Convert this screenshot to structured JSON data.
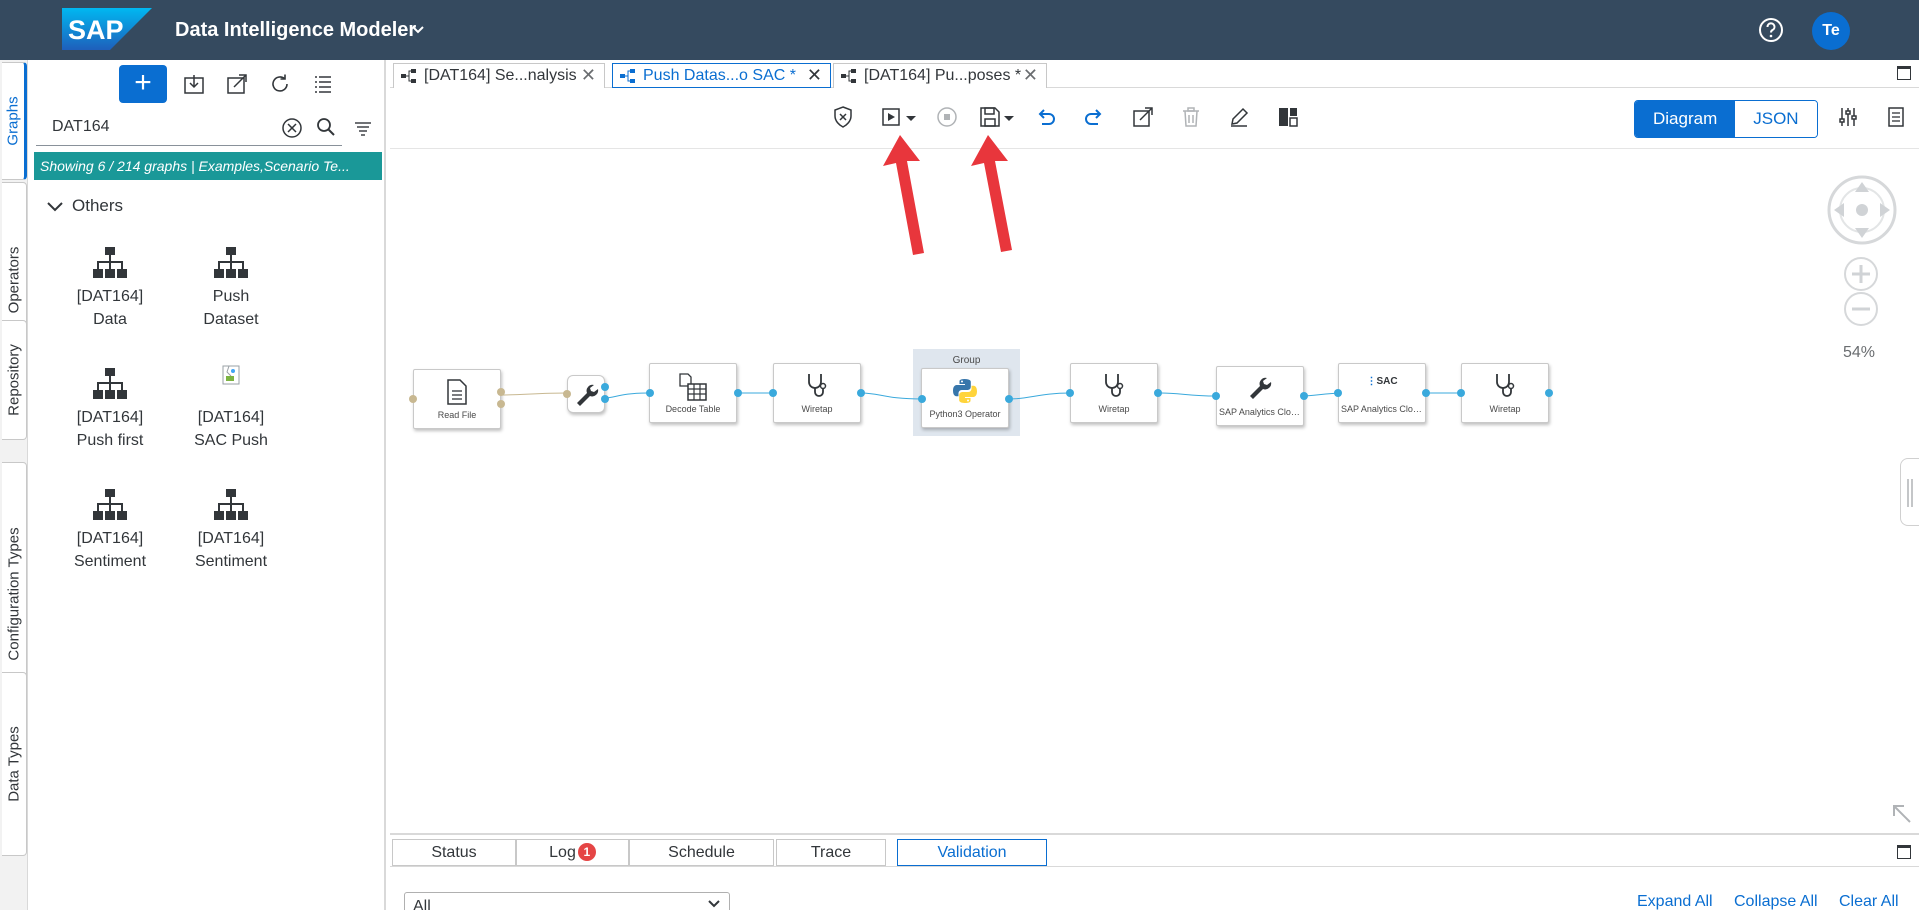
{
  "shell": {
    "logo_text": "SAP",
    "app_title": "Data Intelligence Modeler",
    "user_initials": "Te"
  },
  "vertical_tabs": [
    {
      "label": "Graphs",
      "active": true
    },
    {
      "label": "Operators"
    },
    {
      "label": "Repository"
    },
    {
      "label": "Configuration Types"
    },
    {
      "label": "Data Types"
    }
  ],
  "left_panel": {
    "search_value": "DAT164",
    "info_text": "Showing 6 / 214 graphs | Examples,Scenario Te...",
    "group_name": "Others",
    "graphs": [
      {
        "line1": "[DAT164]",
        "line2": "Data"
      },
      {
        "line1": "Push",
        "line2": "Dataset"
      },
      {
        "line1": "[DAT164]",
        "line2": "Push first"
      },
      {
        "line1": "[DAT164]",
        "line2": "SAC Push"
      },
      {
        "line1": "[DAT164]",
        "line2": "Sentiment"
      },
      {
        "line1": "[DAT164]",
        "line2": "Sentiment"
      }
    ]
  },
  "doc_tabs": [
    {
      "label": "[DAT164] Se...nalysis"
    },
    {
      "label": "Push Datas...o SAC *",
      "active": true
    },
    {
      "label": "[DAT164] Pu...poses *"
    }
  ],
  "view_toggle": {
    "diagram": "Diagram",
    "json": "JSON"
  },
  "canvas": {
    "group_label": "Group",
    "zoom_level": "54%",
    "nodes": [
      {
        "label": "Read File"
      },
      {
        "label": "Decode Table"
      },
      {
        "label": "Wiretap"
      },
      {
        "label": "Python3 Operator"
      },
      {
        "label": "Wiretap"
      },
      {
        "label": "SAP Analytics Cloud ..."
      },
      {
        "label": "SAP Analytics Cloud ..."
      },
      {
        "label": "Wiretap"
      }
    ],
    "sac_icon_text": "SAC"
  },
  "bottom": {
    "tabs": [
      {
        "label": "Status"
      },
      {
        "label": "Log",
        "badge": "1"
      },
      {
        "label": "Schedule"
      },
      {
        "label": "Trace"
      },
      {
        "label": "Validation",
        "active": true
      }
    ],
    "filter_value": "All",
    "links": {
      "expand": "Expand All",
      "collapse": "Collapse All",
      "clear": "Clear All"
    }
  },
  "colors": {
    "shell": "#354a5f",
    "accent": "#0a6ed1",
    "info_bar": "#1a9898",
    "annotation_arrow": "#e8363c"
  }
}
